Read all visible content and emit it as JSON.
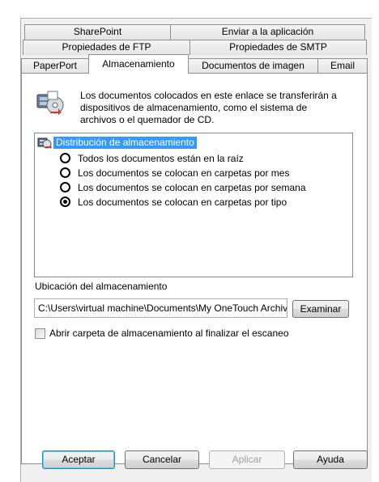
{
  "tabs": {
    "row1": [
      "SharePoint",
      "Enviar a la aplicación"
    ],
    "row2": [
      "Propiedades de FTP",
      "Propiedades de SMTP"
    ],
    "row3": [
      "PaperPort",
      "Almacenamiento",
      "Documentos de imagen",
      "Email"
    ]
  },
  "description": "Los documentos colocados en este enlace se transferirán a dispositivos de almacenamiento, como el sistema de archivos o el quemador de CD.",
  "tree": {
    "root_label": "Distribución de almacenamiento",
    "options": [
      {
        "label": "Todos los documentos están en la raíz",
        "selected": false
      },
      {
        "label": "Los documentos se colocan en carpetas por mes",
        "selected": false
      },
      {
        "label": "Los documentos se colocan en carpetas por semana",
        "selected": false
      },
      {
        "label": "Los documentos se colocan en carpetas por tipo",
        "selected": true
      }
    ]
  },
  "location": {
    "label": "Ubicación del almacenamiento",
    "path_value": "C:\\Users\\virtual machine\\Documents\\My OneTouch Archives",
    "browse_label": "Examinar"
  },
  "open_folder_checkbox": {
    "label": "Abrir carpeta de almacenamiento al finalizar el escaneo",
    "checked": false
  },
  "buttons": {
    "ok": "Aceptar",
    "cancel": "Cancelar",
    "apply": "Aplicar",
    "help": "Ayuda"
  }
}
